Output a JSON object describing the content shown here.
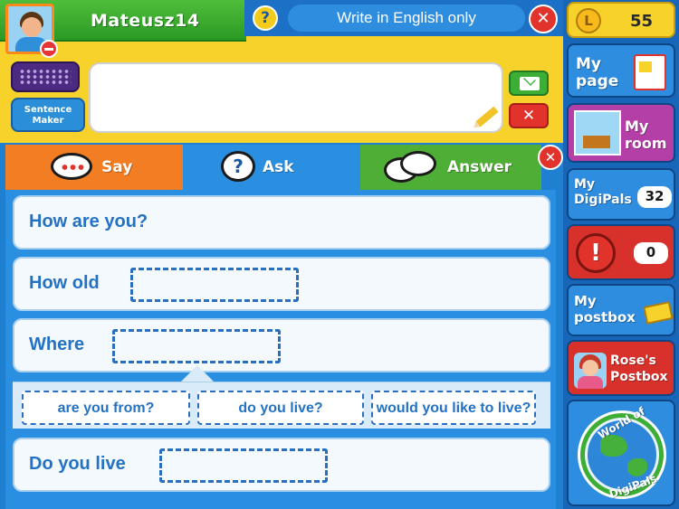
{
  "header": {
    "username": "Mateusz14",
    "help_label": "?",
    "title": "Write in English only",
    "close_label": "✕"
  },
  "composer": {
    "sentence_maker_label": "Sentence\nMaker",
    "message_value": "",
    "clear_label": "✕"
  },
  "tabs": [
    {
      "label": "Say",
      "active": false
    },
    {
      "label": "Ask",
      "active": true
    },
    {
      "label": "Answer",
      "active": false
    }
  ],
  "panel_close_label": "✕",
  "sentences": [
    {
      "stem": "How are you?"
    },
    {
      "stem": "How old"
    },
    {
      "stem": "Where"
    },
    {
      "stem": "Do you live"
    }
  ],
  "options": [
    "are you from?",
    "do you live?",
    "would you like to live?"
  ],
  "sidebar": {
    "coins": "55",
    "coin_symbol": "L",
    "my_page": "My page",
    "my_room": "My room",
    "my_digipals": "My DigiPals",
    "digipals_count": "32",
    "alerts_symbol": "!",
    "alerts_count": "0",
    "my_postbox": "My postbox",
    "roses_postbox": "Rose's Postbox",
    "world_top": "World of",
    "world_bottom": "DigiPals"
  },
  "colors": {
    "orange_tab": "#f27d22",
    "blue_tab": "#2a8fe0",
    "green_tab": "#4fae35",
    "header_yellow": "#f6d22a",
    "close_red": "#e2322c"
  }
}
